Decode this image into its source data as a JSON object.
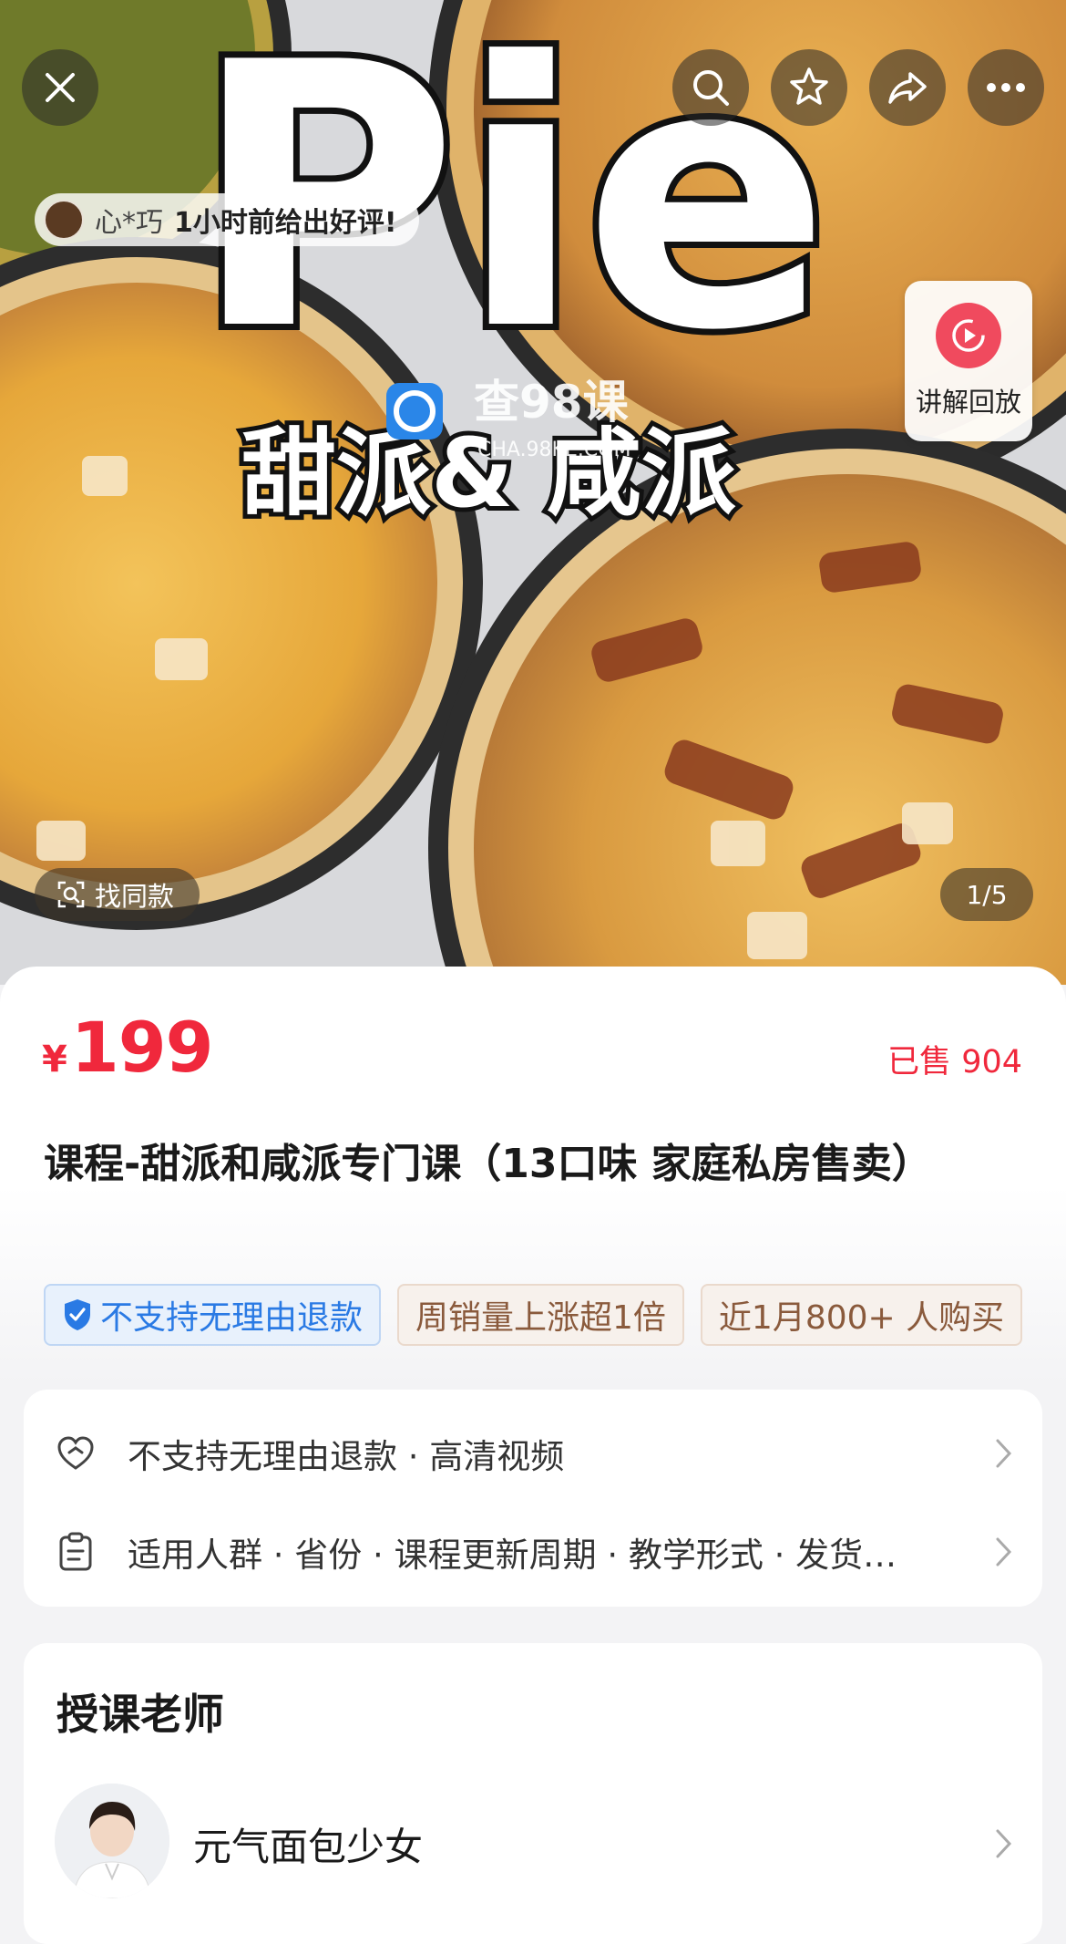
{
  "hero": {
    "cover_text_big": "Pie",
    "cover_text_sub": "甜派& 咸派",
    "watermark_cn": "查98课",
    "watermark_en": "CHA.98KE.COM",
    "reviewer_name": "心*巧",
    "reviewer_message": "1小时前给出好评!",
    "replay_label": "讲解回放",
    "find_same_label": "找同款",
    "page_indicator": "1/5"
  },
  "product": {
    "currency": "¥",
    "price": "199",
    "sold": "已售 904",
    "title": "课程-甜派和咸派专门课（13口味 家庭私房售卖）",
    "tags": [
      {
        "label": "不支持无理由退款",
        "style": "blue"
      },
      {
        "label": "周销量上涨超1倍",
        "style": "tan"
      },
      {
        "label": "近1月800+ 人购买",
        "style": "tan"
      }
    ]
  },
  "info": {
    "row1": "不支持无理由退款 · 高清视频",
    "row2": "适用人群 · 省份 · 课程更新周期 · 教学形式 · 发货…"
  },
  "teacher": {
    "heading": "授课老师",
    "name": "元气面包少女"
  },
  "colors": {
    "accent_red": "#f0283c",
    "tag_blue": "#2a7ae4",
    "tag_tan": "#8a5a3c"
  }
}
